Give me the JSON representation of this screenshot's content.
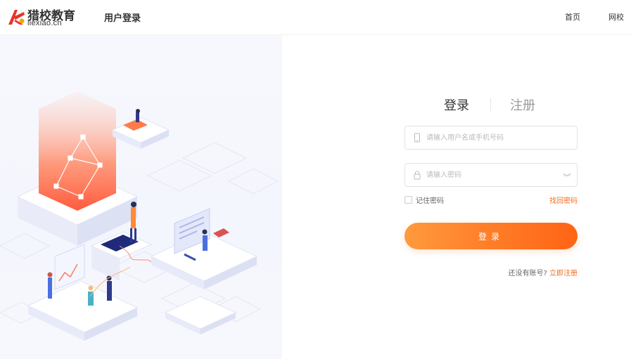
{
  "brand": {
    "name_cn": "猎校教育",
    "name_en": "liexiao.cn",
    "logo_colors": [
      "#e8332a",
      "#f4a21c"
    ]
  },
  "header": {
    "page_title": "用户登录",
    "nav": [
      {
        "label": "首页"
      },
      {
        "label": "网校"
      }
    ]
  },
  "login": {
    "tabs": [
      {
        "label": "登录",
        "active": true
      },
      {
        "label": "注册",
        "active": false
      }
    ],
    "username": {
      "placeholder": "请输入用户名或手机号码",
      "value": "",
      "icon": "phone-icon"
    },
    "password": {
      "placeholder": "请输入密码",
      "value": "",
      "icon": "lock-icon",
      "toggle_icon": "eye-closed-icon"
    },
    "remember_label": "记住密码",
    "remember_checked": false,
    "forgot_label": "找回密码",
    "submit_label": "登录",
    "signup_prompt": "还没有账号?",
    "signup_link": "立即注册",
    "accent_color": "#f16b1d"
  }
}
